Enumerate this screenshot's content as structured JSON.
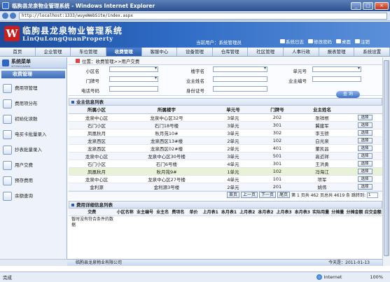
{
  "window": {
    "title": "临朐县龙泉物业管理系统 - Windows Internet Explorer",
    "url": "http://localhost:1333/wuyeWebSite/index.aspx",
    "min": "_",
    "max": "□",
    "close": "×"
  },
  "header": {
    "logo": "W",
    "title": "临朐县龙泉物业管理系统",
    "subtitle": "LinQuLongQuanProperty",
    "user": "当前用户：系统管理员",
    "actions": [
      "系统日志",
      "修改密码",
      "桌面",
      "注销"
    ]
  },
  "menu": [
    "首页",
    "企业管理",
    "车位管理",
    "收费管理",
    "客服中心",
    "设备管理",
    "仓库管理",
    "社区管理",
    "人事行政",
    "报表管理",
    "系统设置"
  ],
  "sidebar": {
    "title": "系统菜单",
    "subtitle": "XITONGCAIDAN",
    "section": "收费管理",
    "items": [
      "费用项管理",
      "费用项分布",
      "初始化读数",
      "电买卡批量录入",
      "抄表批量录入",
      "用户交费",
      "预存费用",
      "余额查询"
    ]
  },
  "breadcrumb": "位置：收费管理>>用户交费",
  "form": {
    "community": "小区名",
    "building": "楼宇名",
    "unit": "单元号",
    "door": "门牌号",
    "owner": "业主姓名",
    "owner_no": "业主编号",
    "phone": "电话号码",
    "id": "身份证号",
    "search": "查 询"
  },
  "list": {
    "title": "业主信息列表",
    "columns": [
      "所属小区",
      "所属楼宇",
      "单元号",
      "门牌号",
      "业主姓名",
      ""
    ],
    "rows": [
      [
        "龙泉中心区",
        "龙泉中心区32号",
        "3单元",
        "202",
        "张祥根",
        "选择"
      ],
      [
        "石门小区",
        "石门18号楼",
        "3单元",
        "301",
        "冀建军",
        "选择"
      ],
      [
        "凤凰秋月",
        "秋月苑10#",
        "3单元",
        "302",
        "李玉德",
        "选择"
      ],
      [
        "龙泉西区",
        "龙泉西区13#楼",
        "2单元",
        "102",
        "白光泉",
        "选择"
      ],
      [
        "龙泉西区",
        "龙泉西区02#楼",
        "2单元",
        "401",
        "董凯昌",
        "选择"
      ],
      [
        "龙泉中心区",
        "龙泉中心区30号楼",
        "3单元",
        "501",
        "高近祥",
        "选择"
      ],
      [
        "石门小区",
        "石门6号楼",
        "4单元",
        "301",
        "王洪勇",
        "选择"
      ],
      [
        "凤凰秋月",
        "秋月苑9#",
        "1单元",
        "102",
        "冯海江",
        "选择"
      ],
      [
        "龙泉中心区",
        "龙泉中心区27号楼",
        "4单元",
        "101",
        "项军",
        "选择"
      ],
      [
        "金利源",
        "金利源3号楼",
        "2单元",
        "201",
        "姚伟",
        "选择"
      ]
    ],
    "pager": {
      "first": "首页",
      "prev": "上一页",
      "next": "下一页",
      "last": "尾页",
      "info": "第 1 页共 462 页总共 4619 条 跳转到:",
      "page": "1"
    }
  },
  "detail": {
    "title": "费用详细信息列表",
    "columns": [
      "交费",
      "小区名称",
      "业主编号",
      "业主名",
      "费项名",
      "单价",
      "上月表1",
      "本月表1",
      "上月表2",
      "本月表2",
      "上月表3",
      "本月表3",
      "实际用量",
      "分摊量",
      "分摊金额",
      "应交金额"
    ],
    "empty": "暂时没有符合条件的数据"
  },
  "footer": {
    "company": "临朐县龙泉物业有限公司",
    "date": "今天是：2011-01-13"
  },
  "status": {
    "done": "完成",
    "zone": "Internet",
    "zoom": "100%"
  }
}
